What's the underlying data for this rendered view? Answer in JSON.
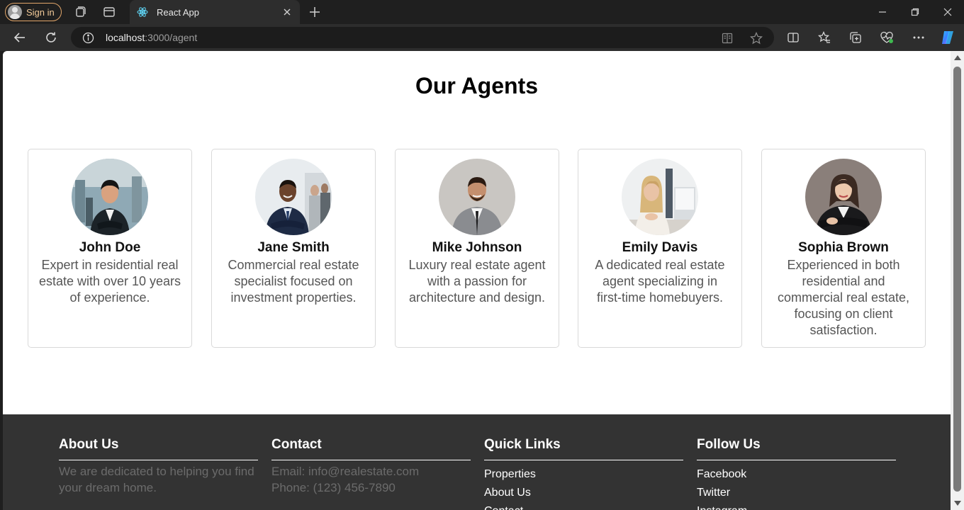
{
  "browser": {
    "signin_label": "Sign in",
    "tab_title": "React App",
    "url_host": "localhost",
    "url_path": ":3000/agent"
  },
  "page": {
    "heading": "Our Agents"
  },
  "agents": [
    {
      "name": "John Doe",
      "description": "Expert in residential real estate with over 10 years of experience."
    },
    {
      "name": "Jane Smith",
      "description": "Commercial real estate specialist focused on investment properties."
    },
    {
      "name": "Mike Johnson",
      "description": "Luxury real estate agent with a passion for architecture and design."
    },
    {
      "name": "Emily Davis",
      "description": "A dedicated real estate agent specializing in first-time homebuyers."
    },
    {
      "name": "Sophia Brown",
      "description": "Experienced in both residential and commercial real estate, focusing on client satisfaction."
    }
  ],
  "footer": {
    "about": {
      "title": "About Us",
      "text": "We are dedicated to helping you find your dream home."
    },
    "contact": {
      "title": "Contact",
      "email": "Email: info@realestate.com",
      "phone": "Phone: (123) 456-7890"
    },
    "quick_links": {
      "title": "Quick Links",
      "items": [
        "Properties",
        "About Us",
        "Contact"
      ]
    },
    "follow": {
      "title": "Follow Us",
      "items": [
        "Facebook",
        "Twitter",
        "Instagram"
      ]
    }
  },
  "colors": {
    "chrome_bg": "#1f1f1f",
    "toolbar_bg": "#2d2d2d",
    "signin_accent": "#e2a66a",
    "footer_bg": "#333333",
    "card_border": "#d9d9d9"
  }
}
